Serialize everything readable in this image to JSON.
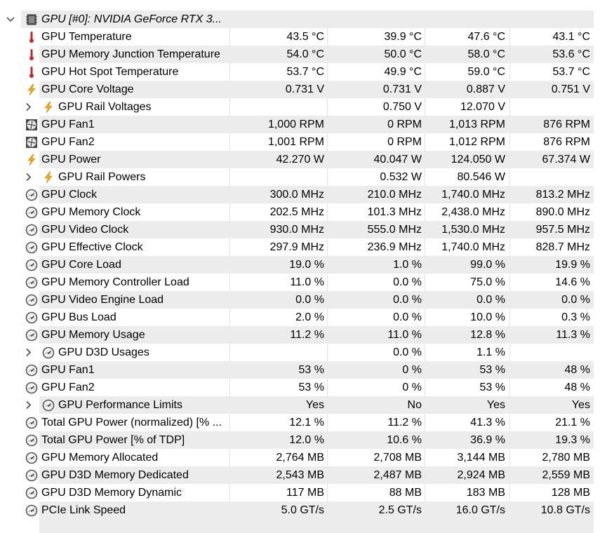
{
  "header": {
    "label": "GPU [#0]: NVIDIA GeForce RTX 3...",
    "icon": "chip-icon",
    "expanded": true
  },
  "rows": [
    {
      "label": "GPU Temperature",
      "icon": "thermometer",
      "values": [
        "43.5 °C",
        "39.9 °C",
        "47.6 °C",
        "43.1 °C"
      ]
    },
    {
      "label": "GPU Memory Junction Temperature",
      "icon": "thermometer",
      "values": [
        "54.0 °C",
        "50.0 °C",
        "58.0 °C",
        "53.6 °C"
      ]
    },
    {
      "label": "GPU Hot Spot Temperature",
      "icon": "thermometer",
      "values": [
        "53.7 °C",
        "49.9 °C",
        "59.0 °C",
        "53.7 °C"
      ]
    },
    {
      "label": "GPU Core Voltage",
      "icon": "bolt",
      "values": [
        "0.731 V",
        "0.731 V",
        "0.887 V",
        "0.751 V"
      ]
    },
    {
      "label": "GPU Rail Voltages",
      "icon": "bolt",
      "expandable": true,
      "values": [
        "",
        "0.750 V",
        "12.070 V",
        ""
      ]
    },
    {
      "label": "GPU Fan1",
      "icon": "fan",
      "values": [
        "1,000 RPM",
        "0 RPM",
        "1,013 RPM",
        "876 RPM"
      ]
    },
    {
      "label": "GPU Fan2",
      "icon": "fan",
      "values": [
        "1,001 RPM",
        "0 RPM",
        "1,012 RPM",
        "876 RPM"
      ]
    },
    {
      "label": "GPU Power",
      "icon": "bolt",
      "values": [
        "42.270 W",
        "40.047 W",
        "124.050 W",
        "67.374 W"
      ]
    },
    {
      "label": "GPU Rail Powers",
      "icon": "bolt",
      "expandable": true,
      "values": [
        "",
        "0.532 W",
        "80.546 W",
        ""
      ]
    },
    {
      "label": "GPU Clock",
      "icon": "gauge",
      "values": [
        "300.0 MHz",
        "210.0 MHz",
        "1,740.0 MHz",
        "813.2 MHz"
      ]
    },
    {
      "label": "GPU Memory Clock",
      "icon": "gauge",
      "values": [
        "202.5 MHz",
        "101.3 MHz",
        "2,438.0 MHz",
        "890.0 MHz"
      ]
    },
    {
      "label": "GPU Video Clock",
      "icon": "gauge",
      "values": [
        "930.0 MHz",
        "555.0 MHz",
        "1,530.0 MHz",
        "957.5 MHz"
      ]
    },
    {
      "label": "GPU Effective Clock",
      "icon": "gauge",
      "values": [
        "297.9 MHz",
        "236.9 MHz",
        "1,740.0 MHz",
        "828.7 MHz"
      ]
    },
    {
      "label": "GPU Core Load",
      "icon": "gauge",
      "values": [
        "19.0 %",
        "1.0 %",
        "99.0 %",
        "19.9 %"
      ]
    },
    {
      "label": "GPU Memory Controller Load",
      "icon": "gauge",
      "values": [
        "11.0 %",
        "0.0 %",
        "75.0 %",
        "14.6 %"
      ]
    },
    {
      "label": "GPU Video Engine Load",
      "icon": "gauge",
      "values": [
        "0.0 %",
        "0.0 %",
        "0.0 %",
        "0.0 %"
      ]
    },
    {
      "label": "GPU Bus Load",
      "icon": "gauge",
      "values": [
        "2.0 %",
        "0.0 %",
        "10.0 %",
        "0.3 %"
      ]
    },
    {
      "label": "GPU Memory Usage",
      "icon": "gauge",
      "values": [
        "11.2 %",
        "11.0 %",
        "12.8 %",
        "11.3 %"
      ]
    },
    {
      "label": "GPU D3D Usages",
      "icon": "gauge",
      "expandable": true,
      "values": [
        "",
        "0.0 %",
        "1.1 %",
        ""
      ]
    },
    {
      "label": "GPU Fan1",
      "icon": "gauge",
      "values": [
        "53 %",
        "0 %",
        "53 %",
        "48 %"
      ]
    },
    {
      "label": "GPU Fan2",
      "icon": "gauge",
      "values": [
        "53 %",
        "0 %",
        "53 %",
        "48 %"
      ]
    },
    {
      "label": "GPU Performance Limits",
      "icon": "gauge",
      "expandable": true,
      "values": [
        "Yes",
        "No",
        "Yes",
        "Yes"
      ]
    },
    {
      "label": "Total GPU Power (normalized) [% ...",
      "icon": "gauge",
      "values": [
        "12.1 %",
        "11.2 %",
        "41.3 %",
        "21.1 %"
      ]
    },
    {
      "label": "Total GPU Power [% of TDP]",
      "icon": "gauge",
      "values": [
        "12.0 %",
        "10.6 %",
        "36.9 %",
        "19.3 %"
      ]
    },
    {
      "label": "GPU Memory Allocated",
      "icon": "gauge",
      "values": [
        "2,764 MB",
        "2,708 MB",
        "3,144 MB",
        "2,780 MB"
      ]
    },
    {
      "label": "GPU D3D Memory Dedicated",
      "icon": "gauge",
      "values": [
        "2,543 MB",
        "2,487 MB",
        "2,924 MB",
        "2,559 MB"
      ]
    },
    {
      "label": "GPU D3D Memory Dynamic",
      "icon": "gauge",
      "values": [
        "117 MB",
        "88 MB",
        "183 MB",
        "128 MB"
      ]
    },
    {
      "label": "PCIe Link Speed",
      "icon": "gauge",
      "values": [
        "5.0 GT/s",
        "2.5 GT/s",
        "16.0 GT/s",
        "10.8 GT/s"
      ]
    }
  ],
  "colors": {
    "stripe": "#ececec",
    "thermometer": "#c62828",
    "bolt": "#f5a623",
    "gauge_ring": "#555555"
  }
}
